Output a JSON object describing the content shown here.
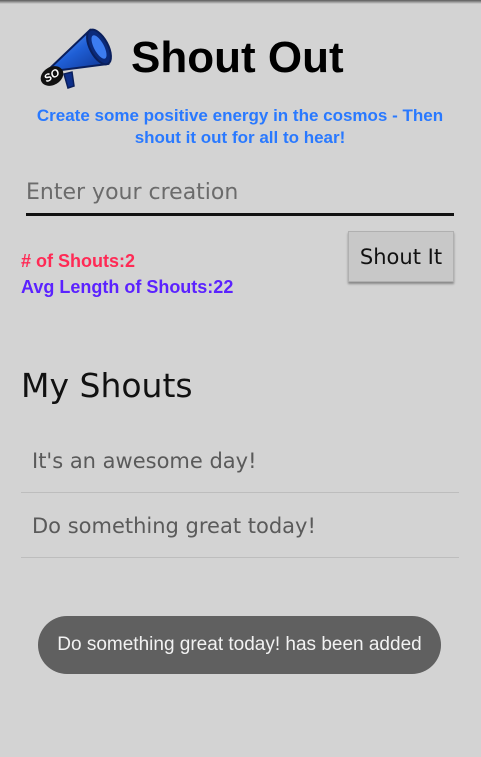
{
  "header": {
    "logo_icon": "megaphone-icon",
    "logo_text": "SO",
    "title": "Shout Out",
    "tagline": "Create some positive energy in the cosmos - Then shout it out for all to hear!"
  },
  "form": {
    "input_placeholder": "Enter your creation",
    "input_value": "",
    "button_label": "Shout It"
  },
  "stats": {
    "shouts_label": "# of Shouts:2",
    "avg_label": "Avg Length of Shouts:22"
  },
  "list": {
    "title": "My Shouts",
    "items": [
      {
        "text": "It's an awesome day!"
      },
      {
        "text": "Do something great today!"
      }
    ]
  },
  "toast": {
    "message": "Do something great today! has been added"
  },
  "colors": {
    "background": "#d3d3d3",
    "tagline": "#2979ff",
    "shouts_count": "#ff2a55",
    "avg_length": "#5b22ff",
    "toast_bg": "#606060"
  }
}
